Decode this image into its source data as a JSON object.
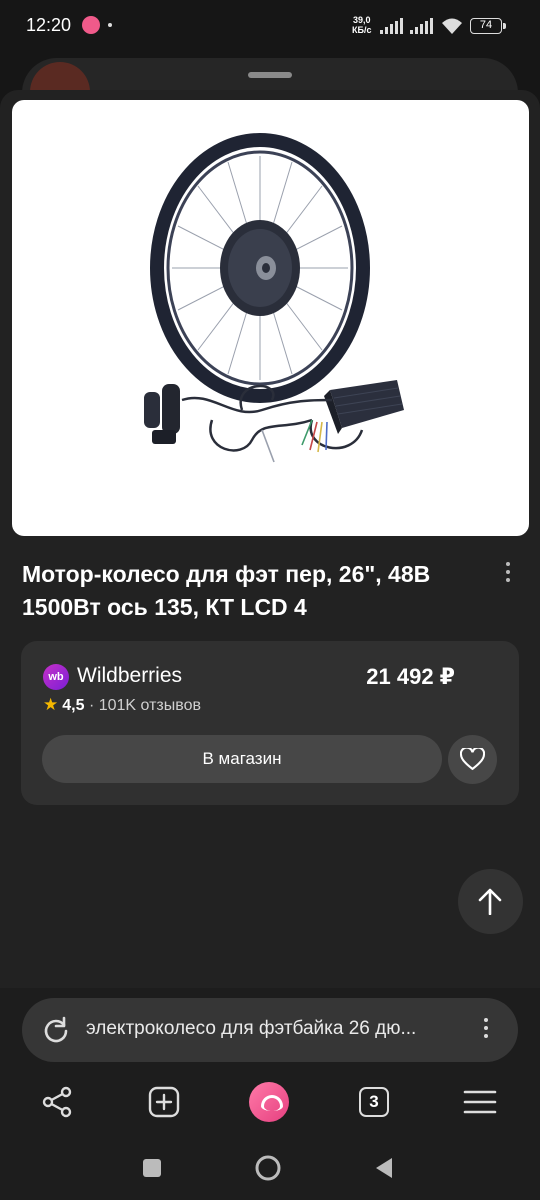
{
  "status_bar": {
    "time": "12:20",
    "speed_value": "39,0",
    "speed_unit": "КБ/с",
    "battery": "74"
  },
  "product": {
    "title": "Мотор-колесо для фэт пер, 26\", 48В 1500Вт ось 135, КТ LCD 4"
  },
  "offer": {
    "store_logo": "wb",
    "store_name": "Wildberries",
    "price": "21 492 ₽",
    "rating": "4,5",
    "reviews": "· 101K отзывов",
    "shop_button_label": "В магазин"
  },
  "search": {
    "query": "электроколесо для фэтбайка 26 дю..."
  },
  "toolbar": {
    "tabs_count": "3"
  },
  "colors": {
    "background": "#161616",
    "sheet": "#222222",
    "card": "#303030",
    "accent_pink": "#e64080",
    "wb_purple": "#a52bcf"
  }
}
